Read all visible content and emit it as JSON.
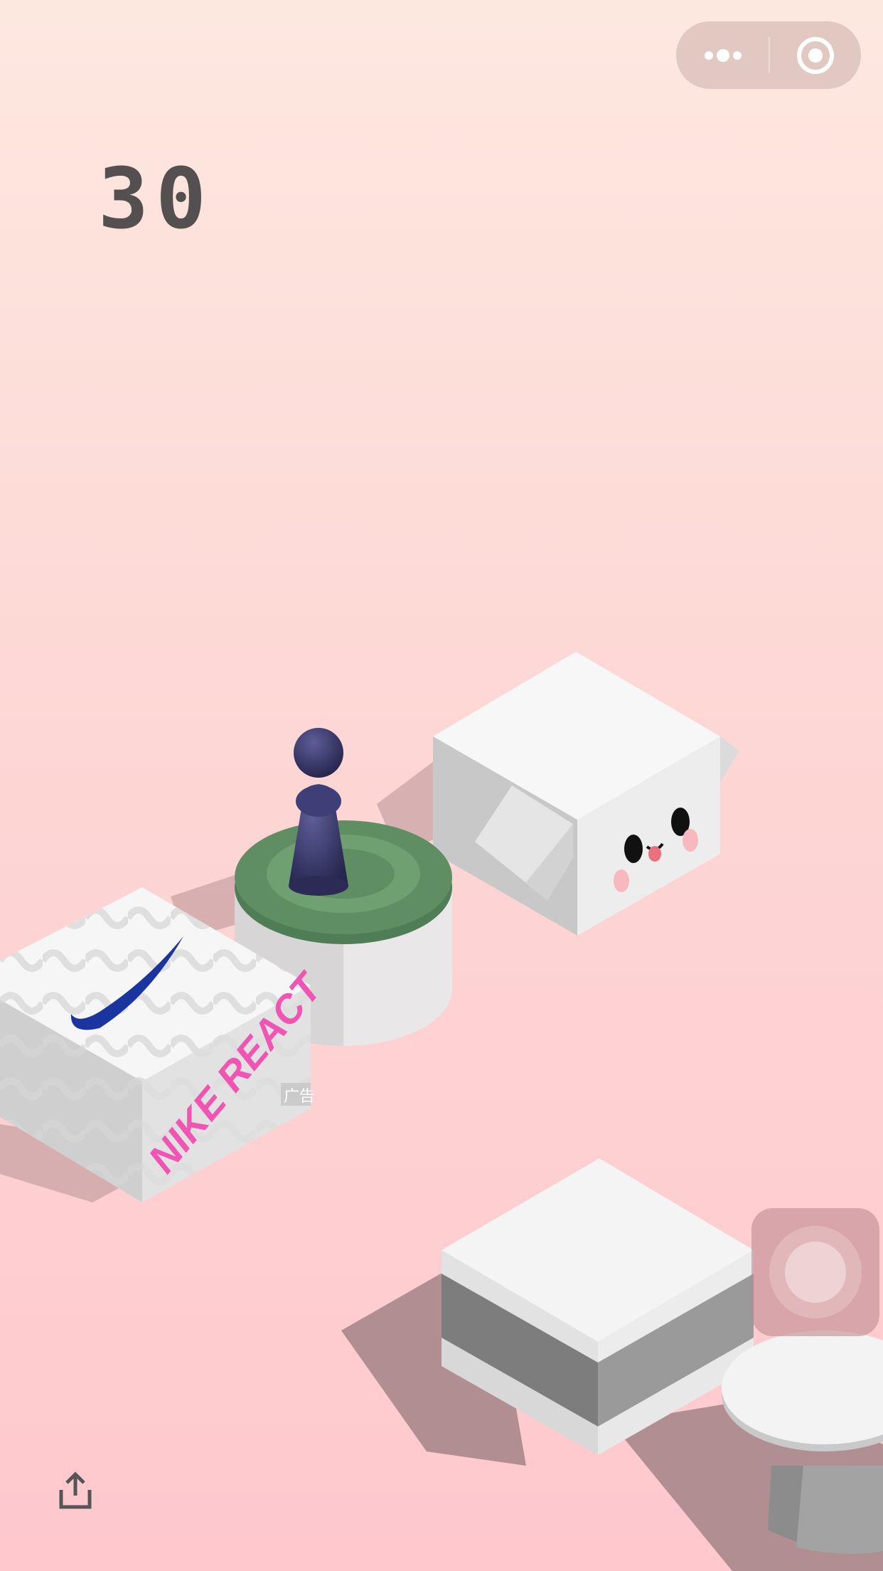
{
  "hud": {
    "score": "30"
  },
  "capsule": {
    "more_icon": "more-dots-icon",
    "close_icon": "target-close-icon"
  },
  "ad_box": {
    "brand_text": "NIKE REACT",
    "ad_label": "广告"
  },
  "toolbar": {
    "share_icon": "share-icon"
  },
  "controls": {
    "joystick_icon": "joystick-knob-icon"
  },
  "colors": {
    "bg_top": "#fde8e0",
    "bg_bottom": "#fec8cd",
    "player": "#3a3a70",
    "green_platform": "#5f8e62",
    "ad_text": "#f055b4",
    "swoosh": "#1a35a0",
    "score_text": "#555050"
  }
}
